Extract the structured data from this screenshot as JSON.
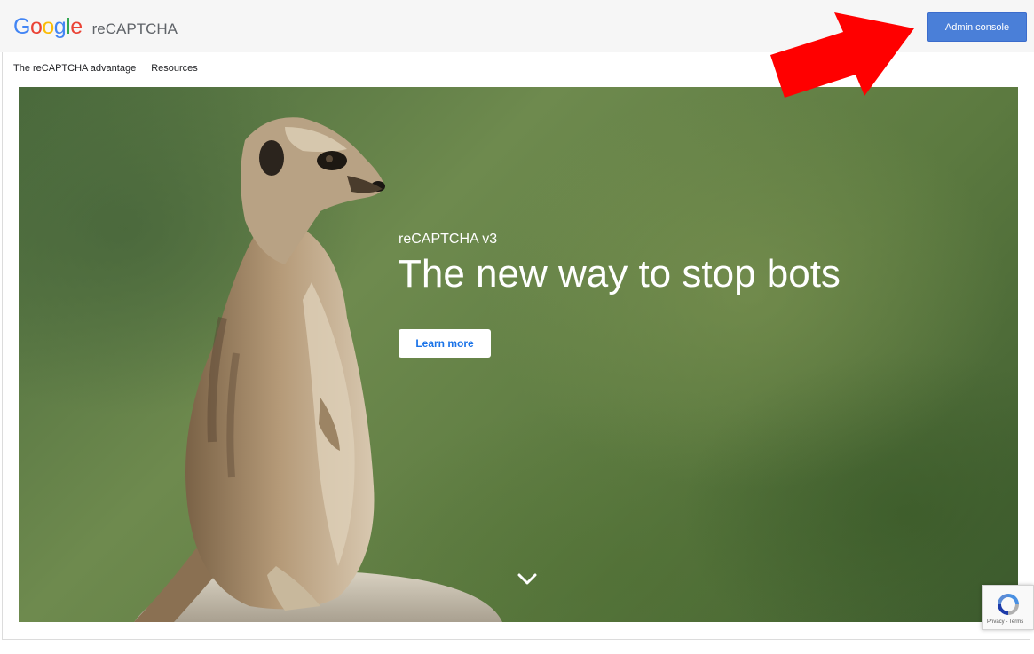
{
  "header": {
    "logo_text": "Google",
    "product_name": "reCAPTCHA",
    "admin_button_label": "Admin console"
  },
  "nav": {
    "items": [
      {
        "label": "The reCAPTCHA advantage"
      },
      {
        "label": "Resources"
      }
    ]
  },
  "hero": {
    "subtitle": "reCAPTCHA v3",
    "title": "The new way to stop bots",
    "cta_label": "Learn more",
    "scroll_icon": "chevron-down-icon"
  },
  "annotation": {
    "icon": "red-arrow-icon",
    "color": "#ff0000"
  },
  "recaptcha_badge": {
    "icon": "recaptcha-icon",
    "terms_text": "Privacy - Terms"
  },
  "colors": {
    "admin_button": "#4a7fd8",
    "cta_text": "#1a73e8",
    "hero_background": "#5c7a40"
  }
}
